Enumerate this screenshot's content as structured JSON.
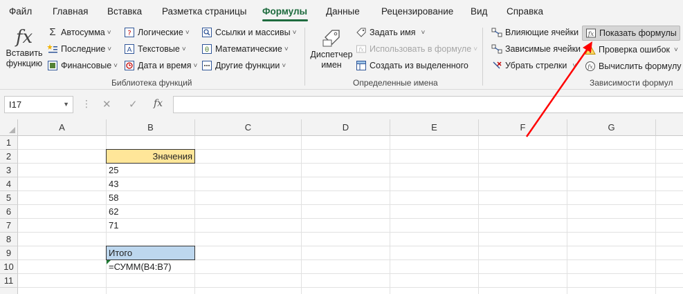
{
  "tabs": [
    "Файл",
    "Главная",
    "Вставка",
    "Разметка страницы",
    "Формулы",
    "Данные",
    "Рецензирование",
    "Вид",
    "Справка"
  ],
  "active_tab": "Формулы",
  "ribbon": {
    "insert_function": {
      "line1": "Вставить",
      "line2": "функцию"
    },
    "autosum": "Автосумма",
    "recent": "Последние",
    "financial": "Финансовые",
    "logical": "Логические",
    "text": "Текстовые",
    "datetime": "Дата и время",
    "lookup": "Ссылки и массивы",
    "math": "Математические",
    "other": "Другие функции",
    "group_library": "Библиотека функций",
    "name_manager": {
      "line1": "Диспетчер",
      "line2": "имен"
    },
    "define_name": "Задать имя",
    "use_in_formula": "Использовать в формуле",
    "create_from_selection": "Создать из выделенного",
    "group_names": "Определенные имена",
    "trace_precedents": "Влияющие ячейки",
    "trace_dependents": "Зависимые ячейки",
    "remove_arrows": "Убрать стрелки",
    "show_formulas": "Показать формулы",
    "error_checking": "Проверка ошибок",
    "evaluate_formula": "Вычислить формулу",
    "group_auditing": "Зависимости формул"
  },
  "formula_bar": {
    "name_box": "I17",
    "fx": "fx",
    "value": ""
  },
  "columns": [
    "A",
    "B",
    "C",
    "D",
    "E",
    "F",
    "G"
  ],
  "rows": [
    "1",
    "2",
    "3",
    "4",
    "5",
    "6",
    "7",
    "8",
    "9",
    "10",
    "11"
  ],
  "cells": {
    "B2": "Значения",
    "B3": "25",
    "B4": "43",
    "B5": "58",
    "B6": "62",
    "B7": "71",
    "B9": "Итого",
    "B10": "=СУММ(B4:B7)"
  },
  "colors": {
    "accent": "#1e6b3e",
    "header_fill": "#ffe699",
    "total_fill": "#bdd7ee",
    "arrow": "#ff0000"
  }
}
